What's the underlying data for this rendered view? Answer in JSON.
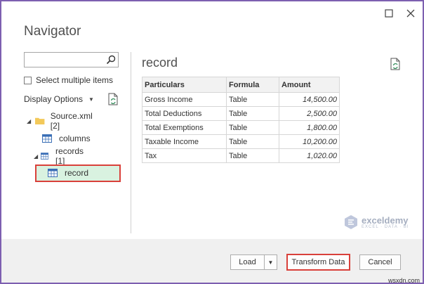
{
  "window": {
    "title": "Navigator",
    "maximize_icon": "maximize-icon",
    "close_icon": "close-icon"
  },
  "left_pane": {
    "search": {
      "value": "",
      "placeholder": ""
    },
    "select_multiple_label": "Select multiple items",
    "select_multiple_checked": false,
    "display_options_label": "Display Options",
    "tree": {
      "source": "Source.xml [2]",
      "columns": "columns",
      "records": "records [1]",
      "record": "record"
    }
  },
  "preview": {
    "title": "record",
    "columns": [
      "Particulars",
      "Formula",
      "Amount"
    ],
    "rows": [
      [
        "Gross Income",
        "Table",
        "14,500.00"
      ],
      [
        "Total Deductions",
        "Table",
        "2,500.00"
      ],
      [
        "Total Exemptions",
        "Table",
        "1,800.00"
      ],
      [
        "Taxable Income",
        "Table",
        "10,200.00"
      ],
      [
        "Tax",
        "Table",
        "1,020.00"
      ]
    ]
  },
  "watermark": {
    "name": "exceldemy",
    "subtitle": "EXCEL · DATA · BI"
  },
  "footer": {
    "load_label": "Load",
    "transform_label": "Transform Data",
    "cancel_label": "Cancel"
  },
  "site_label": "wsxdn.com",
  "colors": {
    "highlight_border": "#d9403a",
    "selected_bg": "#d9f2e0",
    "frame": "#7d5fb0"
  }
}
